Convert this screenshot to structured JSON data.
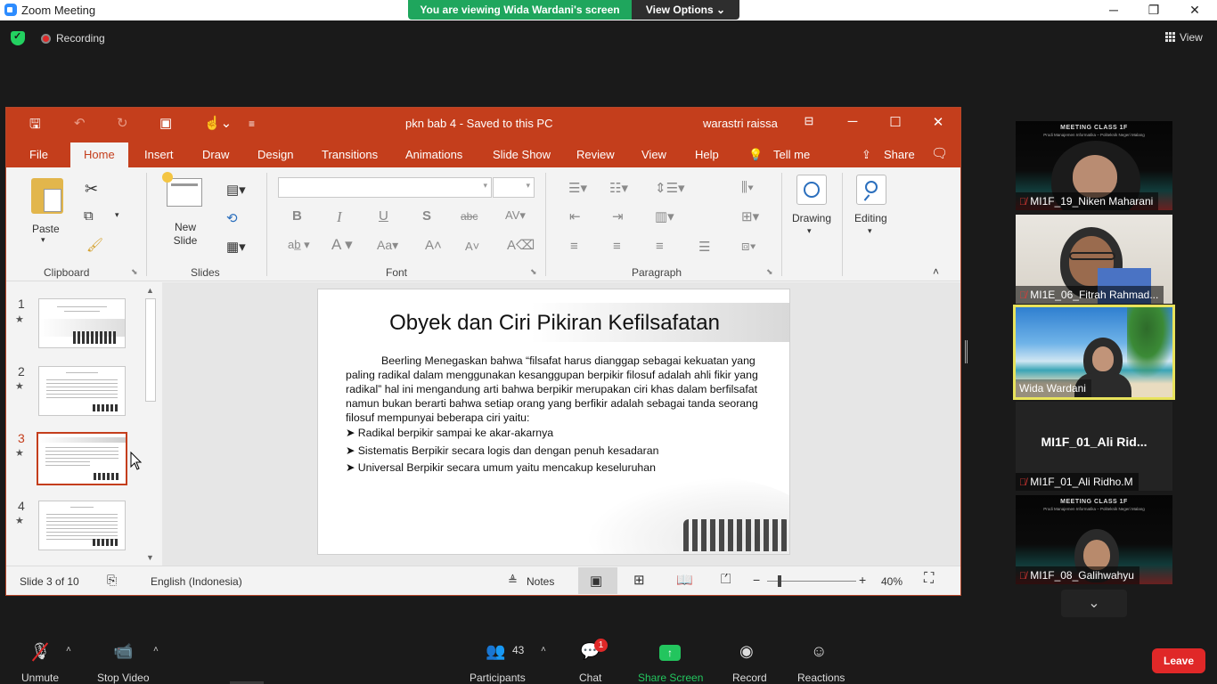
{
  "zoom": {
    "window_title": "Zoom Meeting",
    "viewing_banner": "You are viewing Wida Wardani's screen",
    "view_options": "View Options",
    "recording_label": "Recording",
    "view_label": "View",
    "window_buttons": [
      "─",
      "❐",
      "✕"
    ]
  },
  "ppt": {
    "doc_title": "pkn bab 4  -  Saved to this PC",
    "user": "warastri raissa",
    "tabs": [
      "File",
      "Home",
      "Insert",
      "Draw",
      "Design",
      "Transitions",
      "Animations",
      "Slide Show",
      "Review",
      "View",
      "Help",
      "Tell me",
      "Share"
    ],
    "active_tab": "Home",
    "ribbon": {
      "paste_label": "Paste",
      "new_slide_label": "New Slide",
      "drawing_label": "Drawing",
      "editing_label": "Editing",
      "groups": [
        "Clipboard",
        "Slides",
        "Font",
        "Paragraph"
      ]
    },
    "thumbnails": [
      {
        "num": "1"
      },
      {
        "num": "2"
      },
      {
        "num": "3",
        "selected": true
      },
      {
        "num": "4"
      }
    ],
    "slide": {
      "title": "Obyek dan Ciri Pikiran Kefilsafatan",
      "paragraph": "Beerling Menegaskan bahwa “filsafat harus dianggap sebagai kekuatan yang paling radikal dalam menggunakan kesanggupan berpikir filosuf adalah ahli fikir yang radikal” hal ini mengandung arti bahwa berpikir merupakan ciri khas dalam berfilsafat namun bukan berarti bahwa setiap orang yang berfikir adalah sebagai tanda seorang filosuf mempunyai beberapa ciri yaitu:",
      "bullets": [
        "Radikal  berpikir sampai ke akar-akarnya",
        "Sistematis Berpikir secara logis dan dengan penuh kesadaran",
        "Universal Berpikir secara umum yaitu mencakup keseluruhan"
      ]
    },
    "status": {
      "slide_counter": "Slide 3 of 10",
      "language": "English (Indonesia)",
      "notes": "Notes",
      "zoom": "40%"
    }
  },
  "participants": [
    {
      "name": "MI1F_19_Niken Maharani",
      "muted": true
    },
    {
      "name": "MI1E_06_Fitrah Rahmad...",
      "muted": true
    },
    {
      "name": "Wida Wardani",
      "muted": false,
      "speaking": true
    },
    {
      "name": "MI1F_01_Ali Ridho.M",
      "muted": true,
      "display": "MI1F_01_Ali  Rid..."
    },
    {
      "name": "MI1F_08_Galihwahyu",
      "muted": true
    }
  ],
  "meeting_banner": {
    "title": "MEETING CLASS 1F",
    "subtitle": "Prodi Manajemen Informatika – Politeknik Negeri Malang"
  },
  "toolbar": {
    "unmute": "Unmute",
    "stop_video": "Stop Video",
    "participants": "Participants",
    "participant_count": "43",
    "chat": "Chat",
    "chat_badge": "1",
    "share_screen": "Share Screen",
    "record": "Record",
    "reactions": "Reactions",
    "leave": "Leave"
  },
  "colors": {
    "ppt_accent": "#c43e1c",
    "zoom_green": "#1fa65d",
    "leave_red": "#e02828",
    "speaker_border": "#e8e35c"
  }
}
